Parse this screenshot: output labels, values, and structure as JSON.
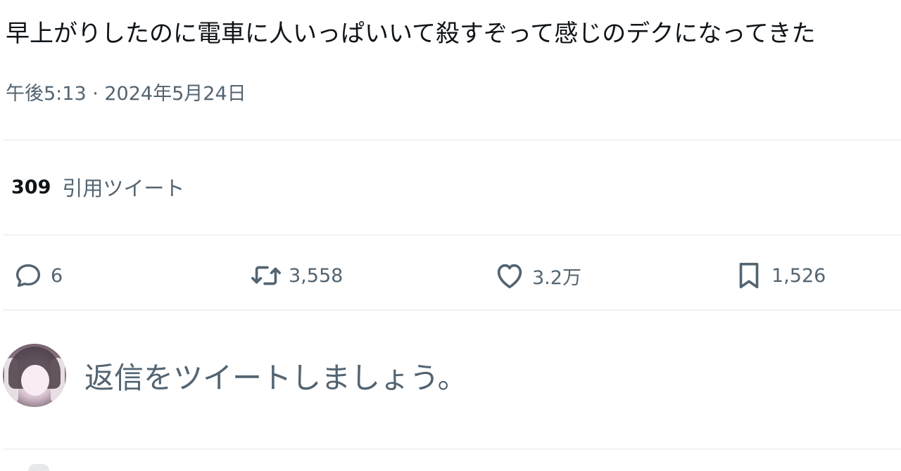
{
  "tweet": {
    "text": "早上がりしたのに電車に人いっぱいいて殺すぞって感じのデクになってきた",
    "timestamp": "午後5:13 · 2024年5月24日"
  },
  "quotes": {
    "count": "309",
    "label": "引用ツイート"
  },
  "actions": {
    "reply": {
      "icon": "reply-icon",
      "count": "6"
    },
    "retweet": {
      "icon": "retweet-icon",
      "count": "3,558"
    },
    "like": {
      "icon": "heart-icon",
      "count": "3.2万"
    },
    "bookmark": {
      "icon": "bookmark-icon",
      "count": "1,526"
    }
  },
  "reply_box": {
    "placeholder": "返信をツイートしましょう。"
  },
  "colors": {
    "text_primary": "#0f1419",
    "text_secondary": "#536471",
    "divider": "#eff3f4"
  }
}
